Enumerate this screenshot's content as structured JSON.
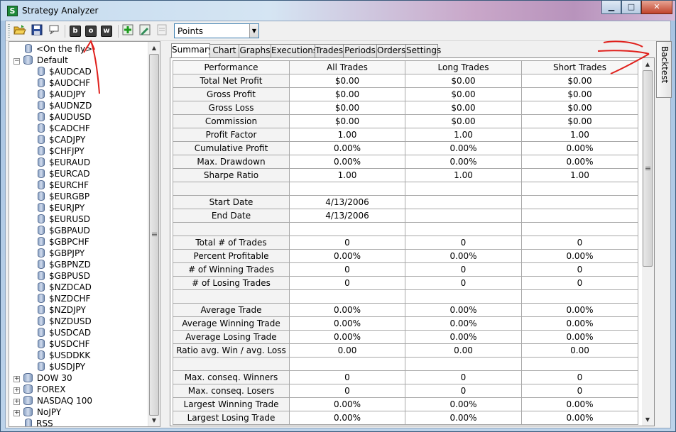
{
  "window": {
    "title": "Strategy Analyzer",
    "minimize": "▁",
    "maximize": "□",
    "close": "✕"
  },
  "toolbar": {
    "icons": [
      "open-folder-icon",
      "save-icon",
      "comment-icon",
      "b-icon",
      "o-icon",
      "w-icon",
      "add-icon",
      "edit-icon",
      "delete-icon"
    ],
    "letters": {
      "b": "b",
      "o": "o",
      "w": "w"
    },
    "units_value": "Points"
  },
  "tree": {
    "items": [
      {
        "label": "<On the fly>",
        "level": 2,
        "expander": ""
      },
      {
        "label": "Default",
        "level": 1,
        "expander": "−"
      },
      {
        "label": "$AUDCAD",
        "level": 3,
        "expander": ""
      },
      {
        "label": "$AUDCHF",
        "level": 3,
        "expander": ""
      },
      {
        "label": "$AUDJPY",
        "level": 3,
        "expander": ""
      },
      {
        "label": "$AUDNZD",
        "level": 3,
        "expander": ""
      },
      {
        "label": "$AUDUSD",
        "level": 3,
        "expander": ""
      },
      {
        "label": "$CADCHF",
        "level": 3,
        "expander": ""
      },
      {
        "label": "$CADJPY",
        "level": 3,
        "expander": ""
      },
      {
        "label": "$CHFJPY",
        "level": 3,
        "expander": ""
      },
      {
        "label": "$EURAUD",
        "level": 3,
        "expander": ""
      },
      {
        "label": "$EURCAD",
        "level": 3,
        "expander": ""
      },
      {
        "label": "$EURCHF",
        "level": 3,
        "expander": ""
      },
      {
        "label": "$EURGBP",
        "level": 3,
        "expander": ""
      },
      {
        "label": "$EURJPY",
        "level": 3,
        "expander": ""
      },
      {
        "label": "$EURUSD",
        "level": 3,
        "expander": ""
      },
      {
        "label": "$GBPAUD",
        "level": 3,
        "expander": ""
      },
      {
        "label": "$GBPCHF",
        "level": 3,
        "expander": ""
      },
      {
        "label": "$GBPJPY",
        "level": 3,
        "expander": ""
      },
      {
        "label": "$GBPNZD",
        "level": 3,
        "expander": ""
      },
      {
        "label": "$GBPUSD",
        "level": 3,
        "expander": ""
      },
      {
        "label": "$NZDCAD",
        "level": 3,
        "expander": ""
      },
      {
        "label": "$NZDCHF",
        "level": 3,
        "expander": ""
      },
      {
        "label": "$NZDJPY",
        "level": 3,
        "expander": ""
      },
      {
        "label": "$NZDUSD",
        "level": 3,
        "expander": ""
      },
      {
        "label": "$USDCAD",
        "level": 3,
        "expander": ""
      },
      {
        "label": "$USDCHF",
        "level": 3,
        "expander": ""
      },
      {
        "label": "$USDDKK",
        "level": 3,
        "expander": ""
      },
      {
        "label": "$USDJPY",
        "level": 3,
        "expander": ""
      },
      {
        "label": "DOW 30",
        "level": 1,
        "expander": "+"
      },
      {
        "label": "FOREX",
        "level": 1,
        "expander": "+"
      },
      {
        "label": "NASDAQ 100",
        "level": 1,
        "expander": "+"
      },
      {
        "label": "NoJPY",
        "level": 1,
        "expander": "+"
      },
      {
        "label": "RSS",
        "level": 2,
        "expander": ""
      }
    ]
  },
  "tabs": [
    "Summary",
    "Chart",
    "Graphs",
    "Executions",
    "Trades",
    "Periods",
    "Orders",
    "Settings"
  ],
  "active_tab": "Summary",
  "side_tab": "Backtest",
  "grid": {
    "headers": [
      "Performance",
      "All Trades",
      "Long Trades",
      "Short Trades"
    ],
    "rows": [
      [
        "Total Net Profit",
        "$0.00",
        "$0.00",
        "$0.00"
      ],
      [
        "Gross Profit",
        "$0.00",
        "$0.00",
        "$0.00"
      ],
      [
        "Gross Loss",
        "$0.00",
        "$0.00",
        "$0.00"
      ],
      [
        "Commission",
        "$0.00",
        "$0.00",
        "$0.00"
      ],
      [
        "Profit Factor",
        "1.00",
        "1.00",
        "1.00"
      ],
      [
        "Cumulative Profit",
        "0.00%",
        "0.00%",
        "0.00%"
      ],
      [
        "Max. Drawdown",
        "0.00%",
        "0.00%",
        "0.00%"
      ],
      [
        "Sharpe Ratio",
        "1.00",
        "1.00",
        "1.00"
      ],
      [
        "",
        "",
        "",
        ""
      ],
      [
        "Start Date",
        "4/13/2006",
        "",
        ""
      ],
      [
        "End Date",
        "4/13/2006",
        "",
        ""
      ],
      [
        "",
        "",
        "",
        ""
      ],
      [
        "Total # of Trades",
        "0",
        "0",
        "0"
      ],
      [
        "Percent Profitable",
        "0.00%",
        "0.00%",
        "0.00%"
      ],
      [
        "# of Winning Trades",
        "0",
        "0",
        "0"
      ],
      [
        "# of Losing Trades",
        "0",
        "0",
        "0"
      ],
      [
        "",
        "",
        "",
        ""
      ],
      [
        "Average Trade",
        "0.00%",
        "0.00%",
        "0.00%"
      ],
      [
        "Average Winning Trade",
        "0.00%",
        "0.00%",
        "0.00%"
      ],
      [
        "Average Losing Trade",
        "0.00%",
        "0.00%",
        "0.00%"
      ],
      [
        "Ratio avg. Win / avg. Loss",
        "0.00",
        "0.00",
        "0.00"
      ],
      [
        "",
        "",
        "",
        ""
      ],
      [
        "Max. conseq. Winners",
        "0",
        "0",
        "0"
      ],
      [
        "Max. conseq. Losers",
        "0",
        "0",
        "0"
      ],
      [
        "Largest Winning Trade",
        "0.00%",
        "0.00%",
        "0.00%"
      ],
      [
        "Largest Losing Trade",
        "0.00%",
        "0.00%",
        "0.00%"
      ]
    ]
  },
  "colors": {
    "annotation": "#e0201c",
    "titlebar_accent": "#b893bc"
  }
}
